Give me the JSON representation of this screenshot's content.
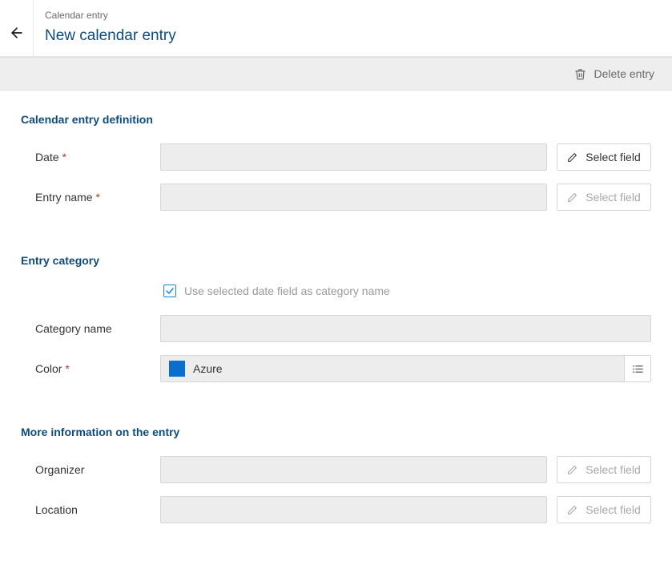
{
  "breadcrumb": "Calendar entry",
  "title": "New calendar entry",
  "toolbar": {
    "delete_label": "Delete entry"
  },
  "buttons": {
    "select_field": "Select field"
  },
  "section1": {
    "title": "Calendar entry definition",
    "date_label": "Date",
    "entry_name_label": "Entry name",
    "date_value": "",
    "entry_name_value": ""
  },
  "section2": {
    "title": "Entry category",
    "checkbox_label": "Use selected date field as category name",
    "checkbox_checked": true,
    "category_name_label": "Category name",
    "category_name_value": "",
    "color_label": "Color",
    "color_name": "Azure",
    "color_hex": "#0a6ed1"
  },
  "section3": {
    "title": "More information on the entry",
    "organizer_label": "Organizer",
    "organizer_value": "",
    "location_label": "Location",
    "location_value": ""
  }
}
